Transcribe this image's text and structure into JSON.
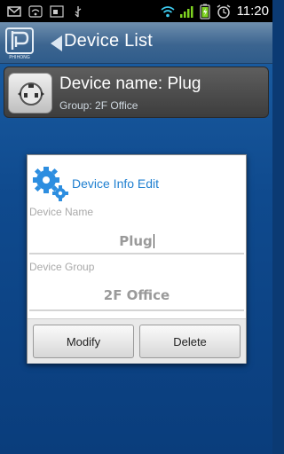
{
  "status_bar": {
    "time": "11:20",
    "icons": [
      "gmail-icon",
      "wifi-hotspot-icon",
      "calendar-icon",
      "usb-icon",
      "wifi-icon",
      "signal-icon",
      "battery-icon",
      "alarm-icon"
    ]
  },
  "header": {
    "title": "Device List",
    "logo_text": "PHIHONG"
  },
  "device": {
    "name_line": "Device name: Plug",
    "group_line": "Group: 2F Office"
  },
  "dialog": {
    "title": "Device Info Edit",
    "device_name_label": "Device Name",
    "device_name_value": "Plug",
    "device_group_label": "Device Group",
    "device_group_value": "2F Office",
    "modify_label": "Modify",
    "delete_label": "Delete"
  },
  "colors": {
    "accent": "#1e7fd0",
    "app_background": "#0f4a8e",
    "header_background": "#3c6590"
  }
}
